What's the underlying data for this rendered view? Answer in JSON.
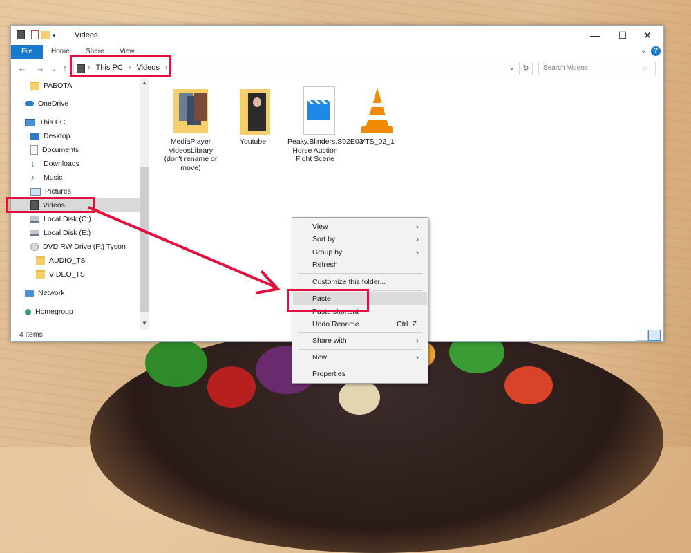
{
  "window": {
    "title": "Videos",
    "ribbon_tabs": [
      "File",
      "Home",
      "Share",
      "View"
    ],
    "controls": {
      "minimize": "—",
      "maximize": "☐",
      "close": "✕"
    },
    "help_icon": "?"
  },
  "address": {
    "path": [
      "This PC",
      "Videos"
    ],
    "search_placeholder": "Search Videos"
  },
  "nav_pane": {
    "items": [
      {
        "label": "РАБОТА",
        "icon": "folder-icon"
      },
      {
        "label": "OneDrive",
        "icon": "onedrive-icon"
      },
      {
        "label": "This PC",
        "icon": "computer-icon"
      },
      {
        "label": "Desktop",
        "icon": "desktop-icon"
      },
      {
        "label": "Documents",
        "icon": "documents-icon"
      },
      {
        "label": "Downloads",
        "icon": "downloads-icon"
      },
      {
        "label": "Music",
        "icon": "music-icon"
      },
      {
        "label": "Pictures",
        "icon": "pictures-icon"
      },
      {
        "label": "Videos",
        "icon": "videos-icon",
        "selected": true
      },
      {
        "label": "Local Disk (C:)",
        "icon": "disk-icon"
      },
      {
        "label": "Local Disk (E:)",
        "icon": "disk-icon"
      },
      {
        "label": "DVD RW Drive (F:) Tyson",
        "icon": "dvd-icon"
      },
      {
        "label": "AUDIO_TS",
        "icon": "folder-icon"
      },
      {
        "label": "VIDEO_TS",
        "icon": "folder-icon"
      },
      {
        "label": "Network",
        "icon": "network-icon"
      },
      {
        "label": "Homegroup",
        "icon": "homegroup-icon"
      }
    ]
  },
  "files": [
    {
      "name": "MediaPlayer VideosLibrary (don't rename or move)",
      "icon": "folder-photos-icon"
    },
    {
      "name": "Youtube",
      "icon": "folder-portrait-icon"
    },
    {
      "name": "Peaky.Blinders.S02E03 Horse Auction Fight Scene",
      "icon": "video-file-icon"
    },
    {
      "name": "VTS_02_1",
      "icon": "vlc-cone-icon"
    }
  ],
  "status": {
    "item_count": "4 items"
  },
  "context_menu": {
    "items": [
      {
        "label": "View",
        "submenu": true
      },
      {
        "label": "Sort by",
        "submenu": true
      },
      {
        "label": "Group by",
        "submenu": true
      },
      {
        "label": "Refresh"
      },
      {
        "label": "Customize this folder..."
      },
      {
        "label": "Paste",
        "hover": true
      },
      {
        "label": "Paste shortcut"
      },
      {
        "label": "Undo Rename",
        "shortcut": "Ctrl+Z"
      },
      {
        "label": "Share with",
        "submenu": true
      },
      {
        "label": "New",
        "submenu": true
      },
      {
        "label": "Properties"
      }
    ]
  },
  "colors": {
    "accent": "#1979ca",
    "highlight": "#e3103f",
    "selection": "#d9d9d9"
  }
}
